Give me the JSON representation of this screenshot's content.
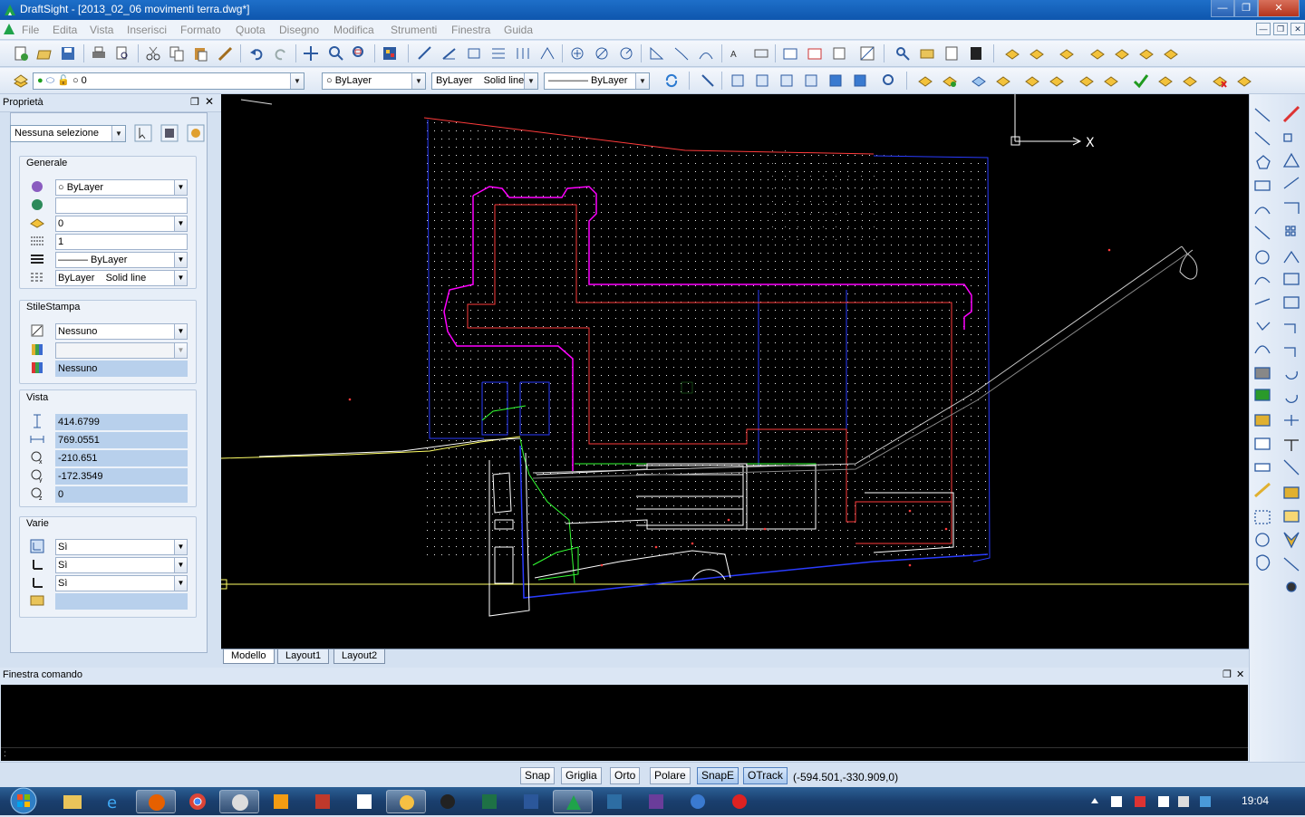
{
  "window": {
    "title": "DraftSight - [2013_02_06 movimenti terra.dwg*]",
    "buttons": [
      "—",
      "❐",
      "✕"
    ]
  },
  "menu": [
    "File",
    "Edita",
    "Vista",
    "Inserisci",
    "Formato",
    "Quota",
    "Disegno",
    "Modifica",
    "Strumenti",
    "Finestra",
    "Guida"
  ],
  "layer_toolbar": {
    "layer_value": "0",
    "color_value": "ByLayer",
    "linestyle_value": "ByLayer",
    "linestyle_type": "Solid line",
    "lineweight_value": "———— ByLayer"
  },
  "properties": {
    "title": "Proprietà",
    "selection": "Nessuna selezione",
    "general_title": "Generale",
    "general": [
      "ByLayer",
      "",
      "0",
      "1",
      "——— ByLayer",
      "ByLayer",
      "Solid line"
    ],
    "print_title": "StileStampa",
    "print": [
      "Nessuno",
      "",
      "Nessuno"
    ],
    "view_title": "Vista",
    "view": [
      "414.6799",
      "769.0551",
      "-210.651",
      "-172.3549",
      "0"
    ],
    "misc_title": "Varie",
    "misc": [
      "Sì",
      "Sì",
      "Sì",
      ""
    ]
  },
  "tabs": [
    "Modello",
    "Layout1",
    "Layout2"
  ],
  "command_window": {
    "title": "Finestra comando",
    "prompt": ":"
  },
  "status": {
    "buttons": [
      "Snap",
      "Griglia",
      "Orto",
      "Polare",
      "SnapE",
      "OTrack"
    ],
    "active": [
      "SnapE",
      "OTrack"
    ],
    "coords": "(-594.501,-330.909,0)"
  },
  "ucs": {
    "x_label": "X"
  },
  "taskbar": {
    "clock": "19:04"
  },
  "colors": {
    "titlebar": "#1565c0",
    "canvas": "#000000",
    "magenta": "#ff00ff",
    "red": "#ff3b3b",
    "blue": "#2a3cff",
    "yellow": "#ffff66",
    "green": "#33ff33"
  }
}
